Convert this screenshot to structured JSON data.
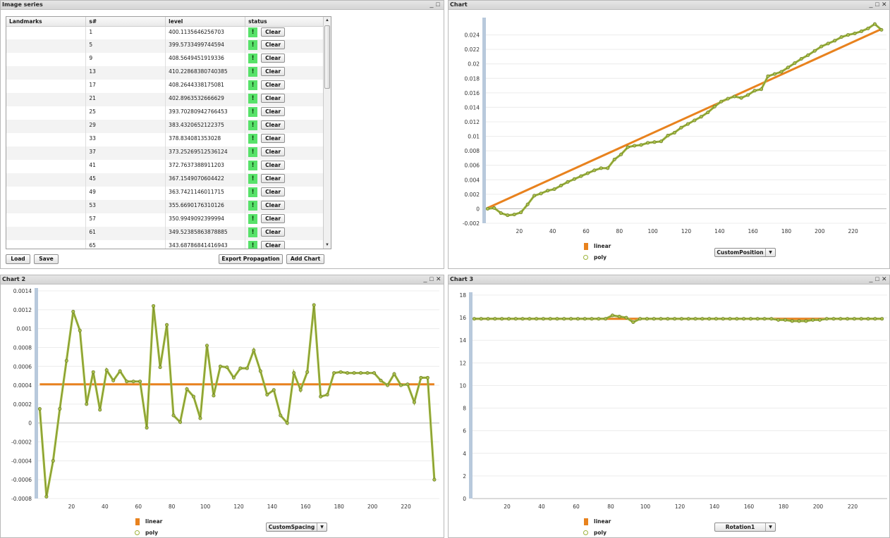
{
  "image_series": {
    "title": "Image series",
    "columns": [
      "Landmarks",
      "s#",
      "level",
      "status"
    ],
    "rows": [
      {
        "landmark": "",
        "s": "1",
        "level": "400.1135646256703"
      },
      {
        "landmark": "",
        "s": "5",
        "level": "399.5733499744594"
      },
      {
        "landmark": "",
        "s": "9",
        "level": "408.5649451919336"
      },
      {
        "landmark": "",
        "s": "13",
        "level": "410.22868380740385"
      },
      {
        "landmark": "",
        "s": "17",
        "level": "408.2644338175081"
      },
      {
        "landmark": "",
        "s": "21",
        "level": "402.8963532666629"
      },
      {
        "landmark": "",
        "s": "25",
        "level": "393.70280942766453"
      },
      {
        "landmark": "",
        "s": "29",
        "level": "383.4320652122375"
      },
      {
        "landmark": "",
        "s": "33",
        "level": "378.834081353028"
      },
      {
        "landmark": "",
        "s": "37",
        "level": "373.25269512536124"
      },
      {
        "landmark": "",
        "s": "41",
        "level": "372.7637388911203"
      },
      {
        "landmark": "",
        "s": "45",
        "level": "367.1549070604422"
      },
      {
        "landmark": "",
        "s": "49",
        "level": "363.7421146011715"
      },
      {
        "landmark": "",
        "s": "53",
        "level": "355.6690176310126"
      },
      {
        "landmark": "",
        "s": "57",
        "level": "350.9949092399994"
      },
      {
        "landmark": "",
        "s": "61",
        "level": "349.52385863878885"
      },
      {
        "landmark": "",
        "s": "65",
        "level": "343.68786841416943"
      }
    ],
    "status_icon": "!",
    "clear_label": "Clear",
    "buttons": {
      "load": "Load",
      "save": "Save",
      "export": "Export Propagation",
      "add_chart": "Add Chart"
    }
  },
  "window_controls": {
    "minimize": "_",
    "maximize": "□",
    "close": "✕"
  },
  "colors": {
    "linear": "#e8821e",
    "poly_line": "#7c8f2a",
    "poly_marker": "#a8bf4a",
    "axis_bar": "#b8c9dc"
  },
  "chart_data": [
    {
      "panel_title": "Chart",
      "type": "line",
      "legend": [
        "linear",
        "poly"
      ],
      "selector": "CustomPosition",
      "xlim": [
        0,
        240
      ],
      "ylim": [
        -0.002,
        0.026
      ],
      "x_ticks": [
        20,
        40,
        60,
        80,
        100,
        120,
        140,
        160,
        180,
        200,
        220
      ],
      "y_ticks": [
        -0.002,
        0,
        0.002,
        0.004,
        0.006,
        0.008,
        0.01,
        0.012,
        0.014,
        0.016,
        0.018,
        0.02,
        0.022,
        0.024
      ],
      "y_tick_labels": [
        "-0.002",
        "0",
        "0.002",
        "0.004",
        "0.006",
        "0.008",
        "0.01",
        "0.012",
        "0.014",
        "0.016",
        "0.018",
        "0.02",
        "0.022",
        "0.024"
      ],
      "series": [
        {
          "name": "linear",
          "x": [
            1,
            237
          ],
          "y": [
            0.0001,
            0.0248
          ]
        },
        {
          "name": "poly",
          "x": [
            1,
            5,
            9,
            13,
            17,
            21,
            25,
            29,
            33,
            37,
            41,
            45,
            49,
            53,
            57,
            61,
            65,
            69,
            73,
            77,
            81,
            85,
            89,
            93,
            97,
            101,
            105,
            109,
            113,
            117,
            121,
            125,
            129,
            133,
            137,
            141,
            145,
            149,
            153,
            157,
            161,
            165,
            169,
            173,
            177,
            181,
            185,
            189,
            193,
            197,
            201,
            205,
            209,
            213,
            217,
            221,
            225,
            229,
            233,
            237
          ],
          "y": [
            0,
            0.0001,
            -0.0006,
            -0.0009,
            -0.0008,
            -0.0005,
            0.0006,
            0.0018,
            0.0021,
            0.0025,
            0.0027,
            0.0032,
            0.0037,
            0.0041,
            0.0045,
            0.0049,
            0.0053,
            0.0056,
            0.0056,
            0.0068,
            0.0075,
            0.0085,
            0.0087,
            0.0088,
            0.0091,
            0.0092,
            0.0093,
            0.0101,
            0.0105,
            0.0112,
            0.0117,
            0.0122,
            0.0127,
            0.0133,
            0.0141,
            0.0148,
            0.0152,
            0.0155,
            0.0153,
            0.0157,
            0.0163,
            0.0165,
            0.0183,
            0.0186,
            0.0189,
            0.0195,
            0.0201,
            0.0207,
            0.0212,
            0.0218,
            0.0224,
            0.0228,
            0.0232,
            0.0237,
            0.024,
            0.0242,
            0.0245,
            0.0249,
            0.0255,
            0.0247
          ]
        }
      ]
    },
    {
      "panel_title": "Chart 2",
      "type": "line",
      "legend": [
        "linear",
        "poly"
      ],
      "selector": "CustomSpacing",
      "xlim": [
        0,
        240
      ],
      "ylim": [
        -0.0008,
        0.0014
      ],
      "x_ticks": [
        20,
        40,
        60,
        80,
        100,
        120,
        140,
        160,
        180,
        200,
        220
      ],
      "y_ticks": [
        -0.0008,
        -0.0006,
        -0.0004,
        -0.0002,
        0,
        0.0002,
        0.0004,
        0.0006,
        0.0008,
        0.001,
        0.0012,
        0.0014
      ],
      "y_tick_labels": [
        "-0.0008",
        "-0.0006",
        "-0.0004",
        "-0.0002",
        "0",
        "0.0002",
        "0.0004",
        "0.0006",
        "0.0008",
        "0.001",
        "0.0012",
        "0.0014"
      ],
      "series": [
        {
          "name": "linear",
          "x": [
            1,
            237
          ],
          "y": [
            0.00041,
            0.00041
          ]
        },
        {
          "name": "poly",
          "x": [
            1,
            5,
            9,
            13,
            17,
            21,
            25,
            29,
            33,
            37,
            41,
            45,
            49,
            53,
            57,
            61,
            65,
            69,
            73,
            77,
            81,
            85,
            89,
            93,
            97,
            101,
            105,
            109,
            113,
            117,
            121,
            125,
            129,
            133,
            137,
            141,
            145,
            149,
            153,
            157,
            161,
            165,
            169,
            173,
            177,
            181,
            185,
            189,
            193,
            197,
            201,
            205,
            209,
            213,
            217,
            221,
            225,
            229,
            233,
            237
          ],
          "y": [
            0.00015,
            -0.00078,
            -0.0004,
            0.00015,
            0.00066,
            0.00118,
            0.00098,
            0.0002,
            0.00054,
            0.00014,
            0.00056,
            0.00045,
            0.00055,
            0.00044,
            0.00044,
            0.00044,
            -5e-05,
            0.00124,
            0.00059,
            0.00104,
            8e-05,
            1e-05,
            0.00036,
            0.00028,
            5e-05,
            0.00082,
            0.00029,
            0.0006,
            0.00059,
            0.00048,
            0.00058,
            0.00058,
            0.00077,
            0.00055,
            0.0003,
            0.00035,
            8e-05,
            0,
            0.00053,
            0.00035,
            0.00054,
            0.00125,
            0.00028,
            0.0003,
            0.00053,
            0.00054,
            0.00053,
            0.00053,
            0.00053,
            0.00053,
            0.00053,
            0.00045,
            0.0004,
            0.00052,
            0.0004,
            0.00041,
            0.00022,
            0.00048,
            0.00048,
            -0.0006
          ]
        }
      ]
    },
    {
      "panel_title": "Chart 3",
      "type": "line",
      "legend": [
        "linear",
        "poly"
      ],
      "selector": "Rotation1",
      "xlim": [
        0,
        240
      ],
      "ylim": [
        0,
        18
      ],
      "x_ticks": [
        20,
        40,
        60,
        80,
        100,
        120,
        140,
        160,
        180,
        200,
        220
      ],
      "y_ticks": [
        0,
        2,
        4,
        6,
        8,
        10,
        12,
        14,
        16,
        18
      ],
      "y_tick_labels": [
        "0",
        "2",
        "4",
        "6",
        "8",
        "10",
        "12",
        "14",
        "16",
        "18"
      ],
      "series": [
        {
          "name": "linear",
          "x": [
            1,
            237
          ],
          "y": [
            15.9,
            15.9
          ]
        },
        {
          "name": "poly",
          "x": [
            1,
            5,
            9,
            13,
            17,
            21,
            25,
            29,
            33,
            37,
            41,
            45,
            49,
            53,
            57,
            61,
            65,
            69,
            73,
            77,
            81,
            85,
            89,
            93,
            97,
            101,
            105,
            109,
            113,
            117,
            121,
            125,
            129,
            133,
            137,
            141,
            145,
            149,
            153,
            157,
            161,
            165,
            169,
            173,
            177,
            181,
            185,
            189,
            193,
            197,
            201,
            205,
            209,
            213,
            217,
            221,
            225,
            229,
            233,
            237
          ],
          "y": [
            15.9,
            15.9,
            15.9,
            15.9,
            15.9,
            15.9,
            15.9,
            15.9,
            15.9,
            15.9,
            15.9,
            15.9,
            15.9,
            15.9,
            15.9,
            15.9,
            15.9,
            15.9,
            15.9,
            15.9,
            16.2,
            16.1,
            16.0,
            15.6,
            15.9,
            15.9,
            15.9,
            15.9,
            15.9,
            15.9,
            15.9,
            15.9,
            15.9,
            15.9,
            15.9,
            15.9,
            15.9,
            15.9,
            15.9,
            15.9,
            15.9,
            15.9,
            15.9,
            15.9,
            15.8,
            15.8,
            15.7,
            15.7,
            15.7,
            15.8,
            15.8,
            15.9,
            15.9,
            15.9,
            15.9,
            15.9,
            15.9,
            15.9,
            15.9,
            15.9
          ]
        }
      ]
    }
  ]
}
